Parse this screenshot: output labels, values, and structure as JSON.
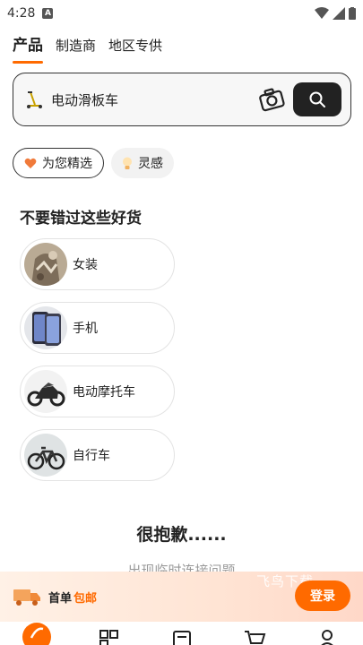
{
  "status_bar": {
    "time": "4:28",
    "badge": "A"
  },
  "tabs": [
    {
      "label": "产品",
      "active": true
    },
    {
      "label": "制造商",
      "active": false
    },
    {
      "label": "地区专供",
      "active": false
    }
  ],
  "search": {
    "query": "电动滑板车",
    "icons": [
      "scooter-icon",
      "camera-icon",
      "search-icon"
    ]
  },
  "chips": [
    {
      "label": "为您精选",
      "icon": "heart-icon",
      "selected": true
    },
    {
      "label": "灵感",
      "icon": "bulb-icon",
      "selected": false
    }
  ],
  "section": {
    "title": "不要错过这些好货"
  },
  "categories": [
    {
      "label": "女装"
    },
    {
      "label": "手机"
    },
    {
      "label": "电动摩托车"
    },
    {
      "label": "自行车"
    }
  ],
  "error": {
    "title": "很抱歉......",
    "subtitle": "出现临时连接问题"
  },
  "promo": {
    "text": "首单",
    "highlight": "包邮",
    "watermark": "飞鸟下载",
    "login_label": "登录"
  },
  "bottom_nav": [
    "home-icon",
    "categories-icon",
    "orders-icon",
    "cart-icon",
    "profile-icon"
  ],
  "colors": {
    "accent": "#ff6a00",
    "dark": "#222222"
  }
}
